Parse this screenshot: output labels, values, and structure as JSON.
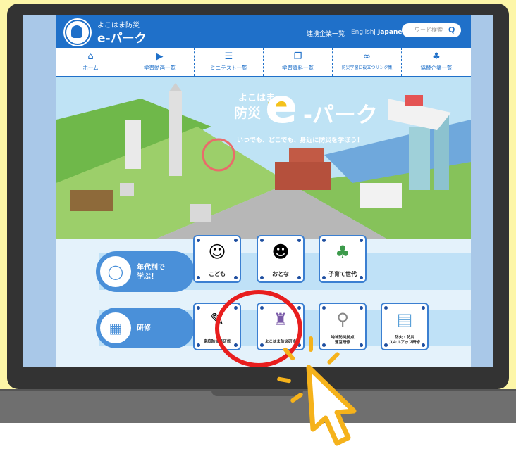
{
  "site": {
    "brand_sub": "よこはま防災",
    "brand_main": "e-パーク",
    "header_links": [
      "連携企業一覧",
      "English",
      "|",
      "Japanese"
    ],
    "search_placeholder": "ワード検索",
    "search_icon": "Q"
  },
  "nav": [
    {
      "label": "ホーム",
      "icon": "home-icon",
      "glyph": "⌂"
    },
    {
      "label": "学習動画一覧",
      "icon": "video-icon",
      "glyph": "▶"
    },
    {
      "label": "ミニテスト一覧",
      "icon": "test-icon",
      "glyph": "☰"
    },
    {
      "label": "学習資料一覧",
      "icon": "book-icon",
      "glyph": "❐"
    },
    {
      "label": "防災学習に役立つリンク集",
      "icon": "link-icon",
      "glyph": "∞"
    },
    {
      "label": "協賛企業一覧",
      "icon": "group-icon",
      "glyph": "♣"
    }
  ],
  "hero": {
    "pre": "よこはま",
    "bousai": "防災",
    "e": "e",
    "park": "-パーク",
    "tagline": "いつでも、どこでも、身近に防災を学ぼう！"
  },
  "categories": {
    "age": {
      "label_line1": "年代別で",
      "label_line2": "学ぶ！",
      "cards": [
        {
          "label": "こども",
          "glyph": "☺"
        },
        {
          "label": "おとな",
          "glyph": "☻"
        },
        {
          "label": "子育て世代",
          "glyph": "♣"
        }
      ]
    },
    "training": {
      "label": "研修",
      "cards": [
        {
          "label": "家庭防災員研修",
          "glyph": "✎"
        },
        {
          "label": "よこはま防災研修",
          "glyph": "♜"
        },
        {
          "label_line1": "地域防災拠点",
          "label_line2": "運営研修",
          "glyph": "⚲"
        },
        {
          "label_line1": "防火・防災",
          "label_line2": "スキルアップ研修",
          "glyph": "▤"
        }
      ]
    }
  },
  "highlight_color": "#e81e1e",
  "accent_color": "#1f70c9"
}
